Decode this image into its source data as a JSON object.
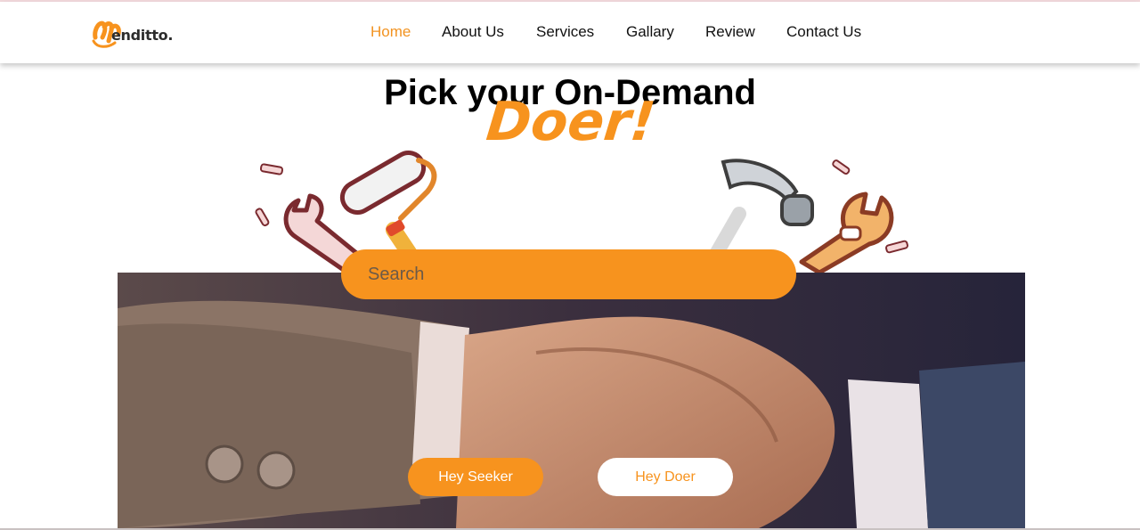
{
  "brand": {
    "logo_text": "enditto.",
    "logo_icon": "menditto-m-logo-icon",
    "accent_color": "#f7931e"
  },
  "nav": {
    "items": [
      {
        "label": "Home",
        "active": true
      },
      {
        "label": "About Us",
        "active": false
      },
      {
        "label": "Services",
        "active": false
      },
      {
        "label": "Gallary",
        "active": false
      },
      {
        "label": "Review",
        "active": false
      },
      {
        "label": "Contact Us",
        "active": false
      }
    ]
  },
  "hero": {
    "title": "Pick your On-Demand",
    "accent": "Doer!",
    "illustration_icons": [
      "screw-icon",
      "wrench-icon",
      "paint-roller-icon",
      "hammer-icon",
      "adjustable-wrench-icon"
    ],
    "background_image": "handshake-photo"
  },
  "search": {
    "placeholder": "Search",
    "value": ""
  },
  "actions": {
    "seeker_label": "Hey Seeker",
    "doer_label": "Hey Doer"
  }
}
